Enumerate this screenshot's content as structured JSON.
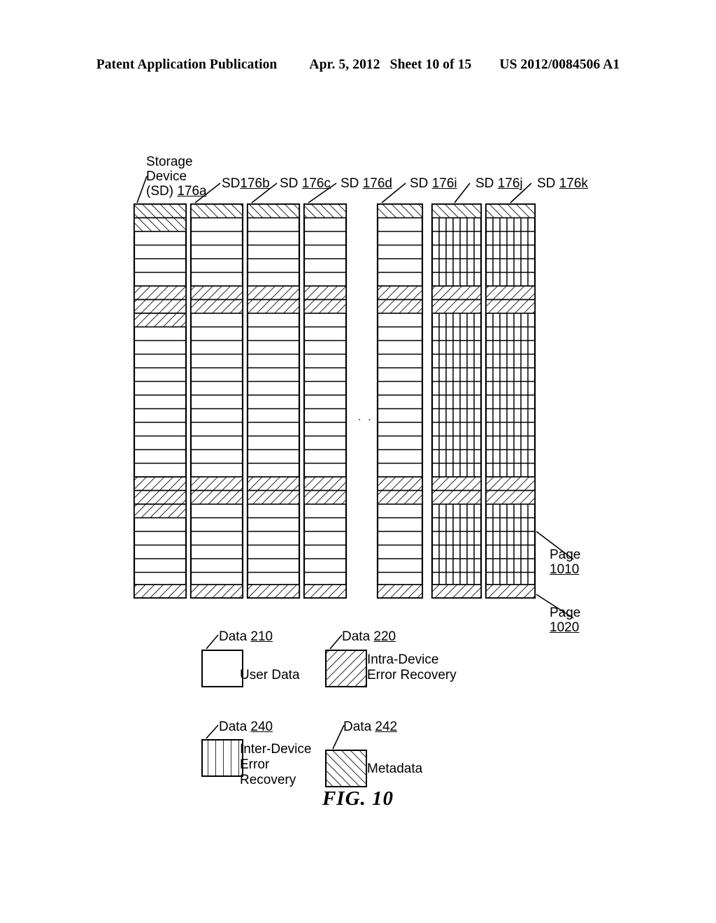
{
  "header": {
    "publication": "Patent Application Publication",
    "date": "Apr. 5, 2012",
    "sheet": "Sheet 10 of 15",
    "number": "US 2012/0084506 A1"
  },
  "figure": {
    "caption": "FIG. 10",
    "ellipsis": ". .",
    "columns": [
      {
        "id": "176a",
        "label_line1": "Storage",
        "label_line2": "Device",
        "label_line3_prefix": "(SD) ",
        "label_ref": "176a",
        "style": "plain"
      },
      {
        "id": "176b",
        "label_prefix": "SD",
        "label_ref": "176b",
        "style": "plain"
      },
      {
        "id": "176c",
        "label_prefix": "SD ",
        "label_ref": "176c",
        "style": "plain"
      },
      {
        "id": "176d",
        "label_prefix": "SD ",
        "label_ref": "176d",
        "style": "plain"
      },
      {
        "id": "176i",
        "label_prefix": "SD ",
        "label_ref": "176i",
        "style": "plain"
      },
      {
        "id": "176j",
        "label_prefix": "SD ",
        "label_ref": "176j",
        "style": "grid"
      },
      {
        "id": "176k",
        "label_prefix": "SD ",
        "label_ref": "176k",
        "style": "grid"
      }
    ],
    "callouts": [
      {
        "name": "Page",
        "ref": "1010"
      },
      {
        "name": "Page",
        "ref": "1020"
      }
    ]
  },
  "legend": {
    "items": [
      {
        "caption_name": "Data ",
        "caption_ref": "210",
        "text": "User Data",
        "swatch": "blank"
      },
      {
        "caption_name": "Data ",
        "caption_ref": "220",
        "text": "Intra-Device\nError Recovery",
        "swatch": "forward-hatch"
      },
      {
        "caption_name": "Data ",
        "caption_ref": "240",
        "text": "Inter-Device\nError\nRecovery",
        "swatch": "vertical-stripes"
      },
      {
        "caption_name": "Data ",
        "caption_ref": "242",
        "text": "Metadata",
        "swatch": "back-hatch"
      }
    ]
  },
  "colors": {
    "ink": "#000000",
    "paper": "#ffffff"
  }
}
